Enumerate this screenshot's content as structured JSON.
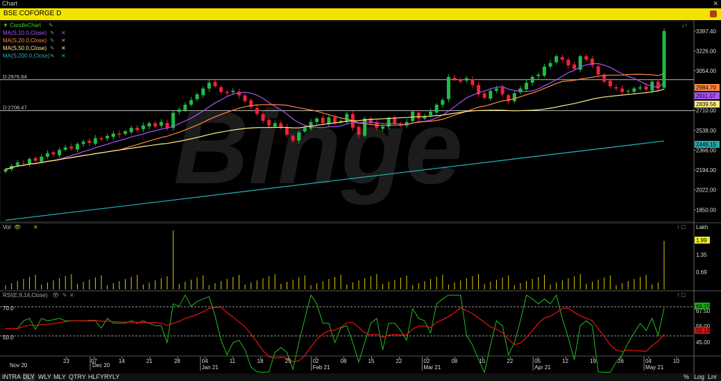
{
  "window": {
    "title": "Chart",
    "close_glyph": "✕"
  },
  "header": {
    "symbol": "BSE COFORGE D"
  },
  "price_panel": {
    "legend": [
      {
        "label": "CandleChart",
        "color": "#33cc33"
      },
      {
        "label": "MA(S,10.0,Close)",
        "color": "#aa55ff"
      },
      {
        "label": "MA(S,20.0,Close)",
        "color": "#ff8844"
      },
      {
        "label": "MA(S,50.0,Close)",
        "color": "#ffee88"
      },
      {
        "label": "MA(S,200.0,Close)",
        "color": "#22aaaa"
      }
    ],
    "ref_lines": [
      "D:2976.64",
      "D:2708.47"
    ],
    "y_ticks": [
      "3397.40",
      "3226.00",
      "3054.00",
      "2710.00",
      "2538.00",
      "2366.00",
      "2194.00",
      "2022.00",
      "1850.00"
    ],
    "price_tags": [
      {
        "text": "2984.70",
        "bg": "#ff8844",
        "fg": "#000"
      },
      {
        "text": "2911.07",
        "bg": "#aa55ff",
        "fg": "#000"
      },
      {
        "text": "2839.56",
        "bg": "#ffee88",
        "fg": "#000"
      },
      {
        "text": "2446.15",
        "bg": "#22aaaa",
        "fg": "#000"
      }
    ],
    "watermark": "Binge"
  },
  "volume_panel": {
    "label": "Vol",
    "unit": "Lakh",
    "y_ticks": [
      "1.35",
      "0.69"
    ],
    "last_tag": "1.99"
  },
  "rsi_panel": {
    "label": "RSI(E,9,14,Close)",
    "levels": [
      "70.0",
      "50.0"
    ],
    "y_ticks": [
      "67.50",
      "56.00",
      "45.00"
    ],
    "tags": [
      {
        "text": "69.15",
        "bg": "#22aa22"
      },
      {
        "text": "52.13",
        "bg": "#dd1111"
      }
    ]
  },
  "x_axis": [
    {
      "label": "23",
      "sub": ""
    },
    {
      "label": "07",
      "sub": ""
    },
    {
      "label": "14",
      "sub": ""
    },
    {
      "label": "21",
      "sub": ""
    },
    {
      "label": "28",
      "sub": ""
    },
    {
      "label": "04",
      "sub": "Jan 21"
    },
    {
      "label": "11",
      "sub": ""
    },
    {
      "label": "18",
      "sub": ""
    },
    {
      "label": "25",
      "sub": ""
    },
    {
      "label": "02",
      "sub": "Feb 21"
    },
    {
      "label": "08",
      "sub": ""
    },
    {
      "label": "15",
      "sub": ""
    },
    {
      "label": "22",
      "sub": ""
    },
    {
      "label": "02",
      "sub": "Mar 21"
    },
    {
      "label": "08",
      "sub": ""
    },
    {
      "label": "15",
      "sub": ""
    },
    {
      "label": "22",
      "sub": ""
    },
    {
      "label": "05",
      "sub": "Apr 21"
    },
    {
      "label": "12",
      "sub": ""
    },
    {
      "label": "19",
      "sub": ""
    },
    {
      "label": "26",
      "sub": ""
    },
    {
      "label": "04",
      "sub": "May 21"
    },
    {
      "label": "10",
      "sub": ""
    }
  ],
  "x_axis_month_start": [
    "Nov 20",
    "Dec 20"
  ],
  "timeframe_tabs": [
    "INTRA",
    "DLY",
    "WLY",
    "MLY",
    "QTRY",
    "HLFYR",
    "YLY"
  ],
  "active_tab": "DLY",
  "corner_labels": [
    "%",
    "Log",
    "Lnr"
  ],
  "colors": {
    "up": "#22bb44",
    "down": "#ee2233",
    "grid": "#333",
    "axis": "#ccc",
    "accent": "#f2e400"
  },
  "chart_data": {
    "type": "candlestick",
    "title": "BSE COFORGE D",
    "ylim": [
      1750,
      3480
    ],
    "closes": [
      2200,
      2230,
      2260,
      2250,
      2290,
      2275,
      2310,
      2340,
      2330,
      2370,
      2390,
      2380,
      2420,
      2440,
      2430,
      2470,
      2460,
      2490,
      2510,
      2500,
      2530,
      2560,
      2540,
      2580,
      2600,
      2570,
      2610,
      2560,
      2690,
      2720,
      2760,
      2800,
      2850,
      2900,
      2950,
      2920,
      2870,
      2860,
      2880,
      2840,
      2790,
      2740,
      2680,
      2620,
      2580,
      2600,
      2560,
      2500,
      2450,
      2520,
      2560,
      2610,
      2640,
      2600,
      2650,
      2600,
      2620,
      2680,
      2560,
      2500,
      2640,
      2600,
      2560,
      2570,
      2640,
      2600,
      2580,
      2610,
      2700,
      2640,
      2660,
      2700,
      2760,
      2800,
      3000,
      2980,
      2960,
      2990,
      2930,
      2850,
      2820,
      2880,
      2900,
      2850,
      2790,
      2860,
      2900,
      2950,
      3000,
      3020,
      3090,
      3120,
      3180,
      3150,
      3100,
      3070,
      3180,
      3150,
      3100,
      3020,
      2960,
      2920,
      2900,
      2870,
      2880,
      2900,
      2910,
      2890,
      2960,
      2900,
      3397
    ],
    "ma200": [
      1760,
      2446.15
    ],
    "volume_last": 1.99,
    "rsi_levels": [
      70,
      50
    ]
  }
}
